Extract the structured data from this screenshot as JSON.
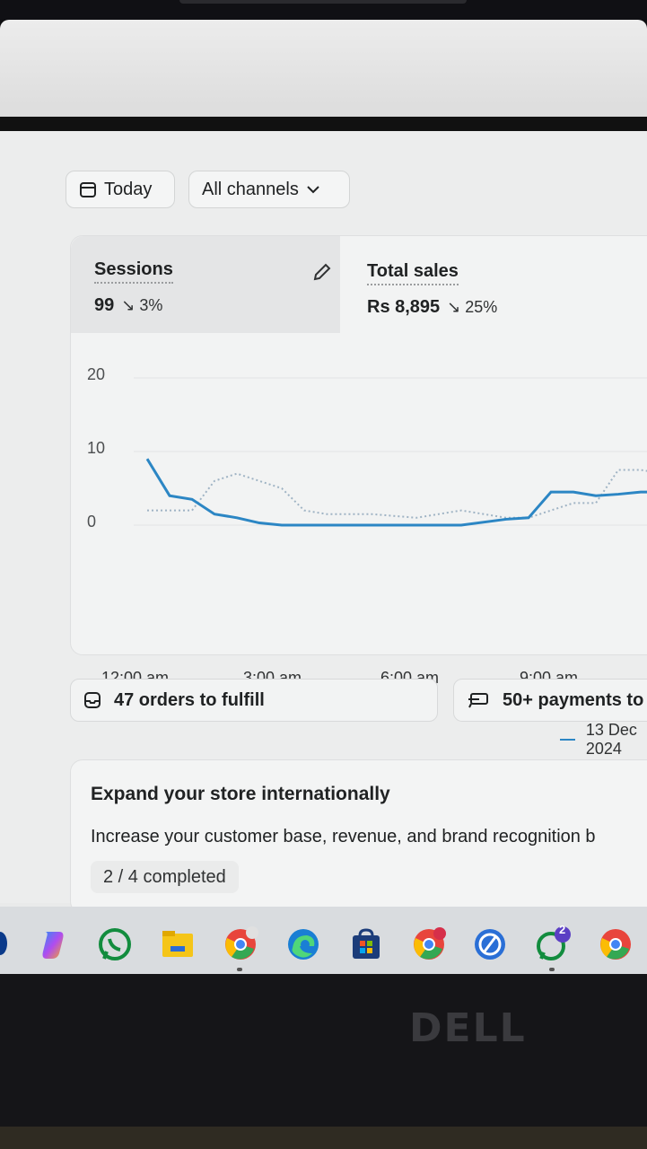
{
  "filters": {
    "date_label": "Today",
    "channel_label": "All channels"
  },
  "metrics": [
    {
      "label": "Sessions",
      "value": "99",
      "delta": "3%"
    },
    {
      "label": "Total sales",
      "value": "Rs 8,895",
      "delta": "25%"
    }
  ],
  "chart_data": {
    "type": "line",
    "y_ticks": [
      "20",
      "10",
      "0"
    ],
    "x_ticks": [
      "12:00 am",
      "3:00 am",
      "6:00 am",
      "9:00 am"
    ],
    "ylim": [
      0,
      20
    ],
    "series": [
      {
        "name": "13 Dec 2024",
        "style": "solid",
        "color": "#2c86c4",
        "x": [
          0,
          0.5,
          1,
          1.5,
          2,
          2.5,
          3,
          4,
          5,
          6,
          7,
          8,
          8.5,
          9,
          9.5,
          10,
          10.5,
          11,
          11.5
        ],
        "y": [
          9,
          4,
          3.5,
          1.5,
          1,
          0.3,
          0,
          0,
          0,
          0,
          0,
          0.8,
          1,
          4.5,
          4.5,
          4,
          4.2,
          4.5,
          4.5
        ]
      },
      {
        "style": "dotted",
        "color": "#9fb3c4",
        "x": [
          0,
          1,
          1.5,
          2,
          3,
          3.5,
          4,
          5,
          6,
          7,
          8,
          8.5,
          9,
          9.5,
          10,
          10.5,
          11,
          11.5
        ],
        "y": [
          2,
          2,
          6,
          7,
          5,
          2,
          1.5,
          1.5,
          1,
          2,
          1,
          1,
          2,
          3,
          3,
          7.5,
          7.5,
          7
        ]
      }
    ],
    "legend": [
      "13 Dec 2024"
    ]
  },
  "tasks": [
    {
      "label": "47 orders to fulfill",
      "icon": "inbox-icon"
    },
    {
      "label": "50+ payments to",
      "icon": "payment-icon"
    }
  ],
  "expand": {
    "title": "Expand your store internationally",
    "description": "Increase your customer base, revenue, and brand recognition b",
    "progress": "2 / 4 completed",
    "completed": 2,
    "total": 4
  },
  "taskbar": {
    "icons": [
      "copilot-icon",
      "whatsapp-icon",
      "file-explorer-icon",
      "chrome-icon",
      "edge-icon",
      "microsoft-store-icon",
      "chrome-profile-icon",
      "chrome-remote-icon",
      "whatsapp-notification-icon",
      "chrome-alt-icon"
    ],
    "whatsapp_badge": "2"
  },
  "bezel": {
    "brand": "DELL"
  }
}
